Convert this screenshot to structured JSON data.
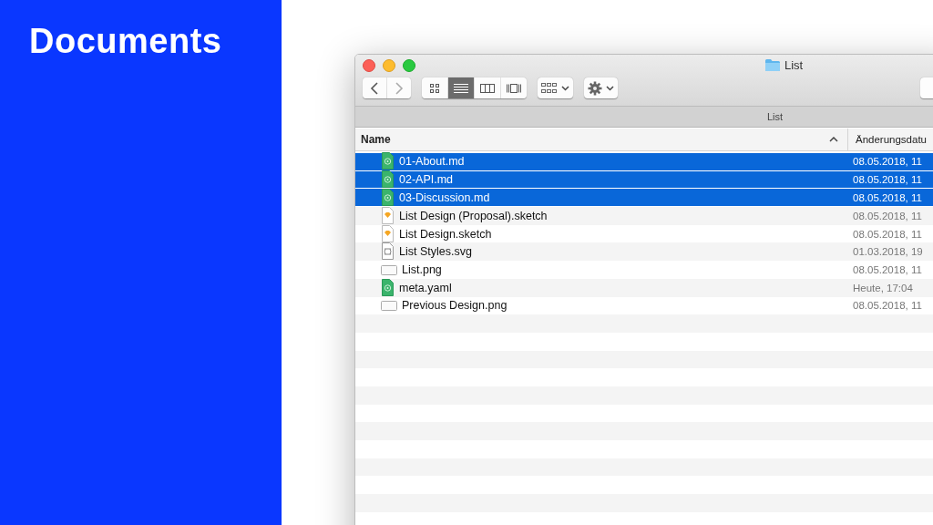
{
  "slide": {
    "title": "Documents"
  },
  "window": {
    "title": "List",
    "path_bar": "List"
  },
  "toolbar": {
    "views": [
      {
        "kind": "icons",
        "selected": false
      },
      {
        "kind": "list",
        "selected": true
      },
      {
        "kind": "columns",
        "selected": false
      },
      {
        "kind": "gallery",
        "selected": false
      }
    ]
  },
  "table": {
    "columns": [
      {
        "label": "Name",
        "sorted": true
      },
      {
        "label": "Änderungsdatu"
      }
    ],
    "rows": [
      {
        "name": "01-About.md",
        "date": "08.05.2018, 11",
        "kind": "md",
        "selected": true
      },
      {
        "name": "02-API.md",
        "date": "08.05.2018, 11",
        "kind": "md",
        "selected": true
      },
      {
        "name": "03-Discussion.md",
        "date": "08.05.2018, 11",
        "kind": "md",
        "selected": true
      },
      {
        "name": "List Design (Proposal).sketch",
        "date": "08.05.2018, 11",
        "kind": "sketch",
        "selected": false
      },
      {
        "name": "List Design.sketch",
        "date": "08.05.2018, 11",
        "kind": "sketch",
        "selected": false
      },
      {
        "name": "List Styles.svg",
        "date": "01.03.2018, 19",
        "kind": "svg",
        "selected": false
      },
      {
        "name": "List.png",
        "date": "08.05.2018, 11",
        "kind": "png",
        "selected": false
      },
      {
        "name": "meta.yaml",
        "date": "Heute, 17:04",
        "kind": "md",
        "selected": false
      },
      {
        "name": "Previous Design.png",
        "date": "08.05.2018, 11",
        "kind": "png",
        "selected": false
      }
    ]
  }
}
